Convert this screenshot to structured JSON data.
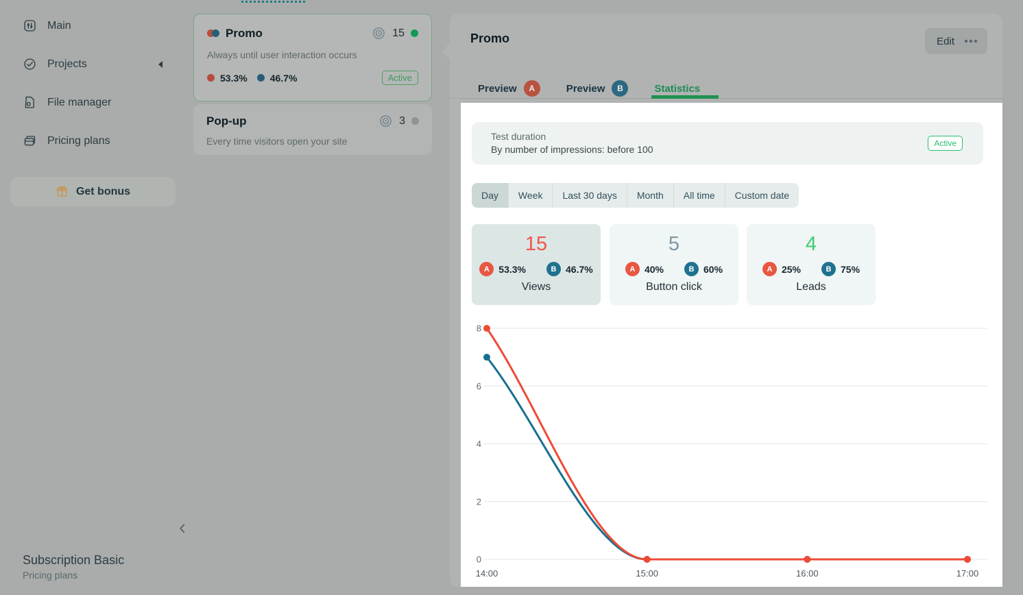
{
  "sidebar": {
    "items": [
      {
        "label": "Main",
        "icon": "main-dashboard-icon"
      },
      {
        "label": "Projects",
        "icon": "projects-icon",
        "collapse_arrow": "triangle-left-icon"
      },
      {
        "label": "File manager",
        "icon": "file-manager-icon"
      },
      {
        "label": "Pricing plans",
        "icon": "pricing-plans-icon"
      }
    ],
    "bonus_button": {
      "label": "Get bonus",
      "icon": "gift-icon",
      "icon_color": "#c8934f"
    },
    "collapse_icon": "chevron-left-icon",
    "subscription": {
      "title": "Subscription Basic",
      "subtitle": "Pricing plans"
    }
  },
  "campaign_list": {
    "cards": [
      {
        "title": "Promo",
        "views": "15",
        "status": "active",
        "description": "Always until user interaction occurs",
        "a_percent": "53.3%",
        "b_percent": "46.7%",
        "badge": "Active",
        "selected": true
      },
      {
        "title": "Pop-up",
        "views": "3",
        "status": "inactive",
        "description": "Every time visitors open your site"
      }
    ]
  },
  "detail_panel": {
    "title": "Promo",
    "edit_button": "Edit",
    "more_icon": "more-options-icon",
    "tabs": [
      {
        "label": "Preview",
        "badge": "A"
      },
      {
        "label": "Preview",
        "badge": "B"
      },
      {
        "label": "Statistics",
        "active": true
      }
    ]
  },
  "statistics": {
    "test_duration": {
      "title": "Test duration",
      "description": "By number of impressions: before 100",
      "badge": "Active"
    },
    "filters": {
      "options": [
        "Day",
        "Week",
        "Last 30 days",
        "Month",
        "All time",
        "Custom date"
      ],
      "selected": "Day"
    },
    "variant_letters": {
      "a": "A",
      "b": "B"
    },
    "metrics": [
      {
        "value": "15",
        "value_color": "#f0564a",
        "a": "53.3%",
        "b": "46.7%",
        "label": "Views",
        "selected": true
      },
      {
        "value": "5",
        "value_color": "#7e96a4",
        "a": "40%",
        "b": "60%",
        "label": "Button click"
      },
      {
        "value": "4",
        "value_color": "#3ecb72",
        "a": "25%",
        "b": "75%",
        "label": "Leads"
      }
    ]
  },
  "colors": {
    "variant_a": "#e85742",
    "variant_b": "#20718f",
    "accent_green": "#2abd6d"
  },
  "chart_data": {
    "type": "line",
    "title": "",
    "xlabel": "",
    "ylabel": "",
    "x": [
      "14:00",
      "15:00",
      "16:00",
      "17:00"
    ],
    "series": [
      {
        "name": "A",
        "color": "#ee4b36",
        "values": [
          8,
          0,
          0,
          0
        ]
      },
      {
        "name": "B",
        "color": "#176f90",
        "values": [
          7,
          0,
          0,
          0
        ]
      }
    ],
    "ylim": [
      0,
      8
    ],
    "yticks": [
      0,
      2,
      4,
      6,
      8
    ],
    "grid": true,
    "legend": "none",
    "curve": "monotone"
  }
}
